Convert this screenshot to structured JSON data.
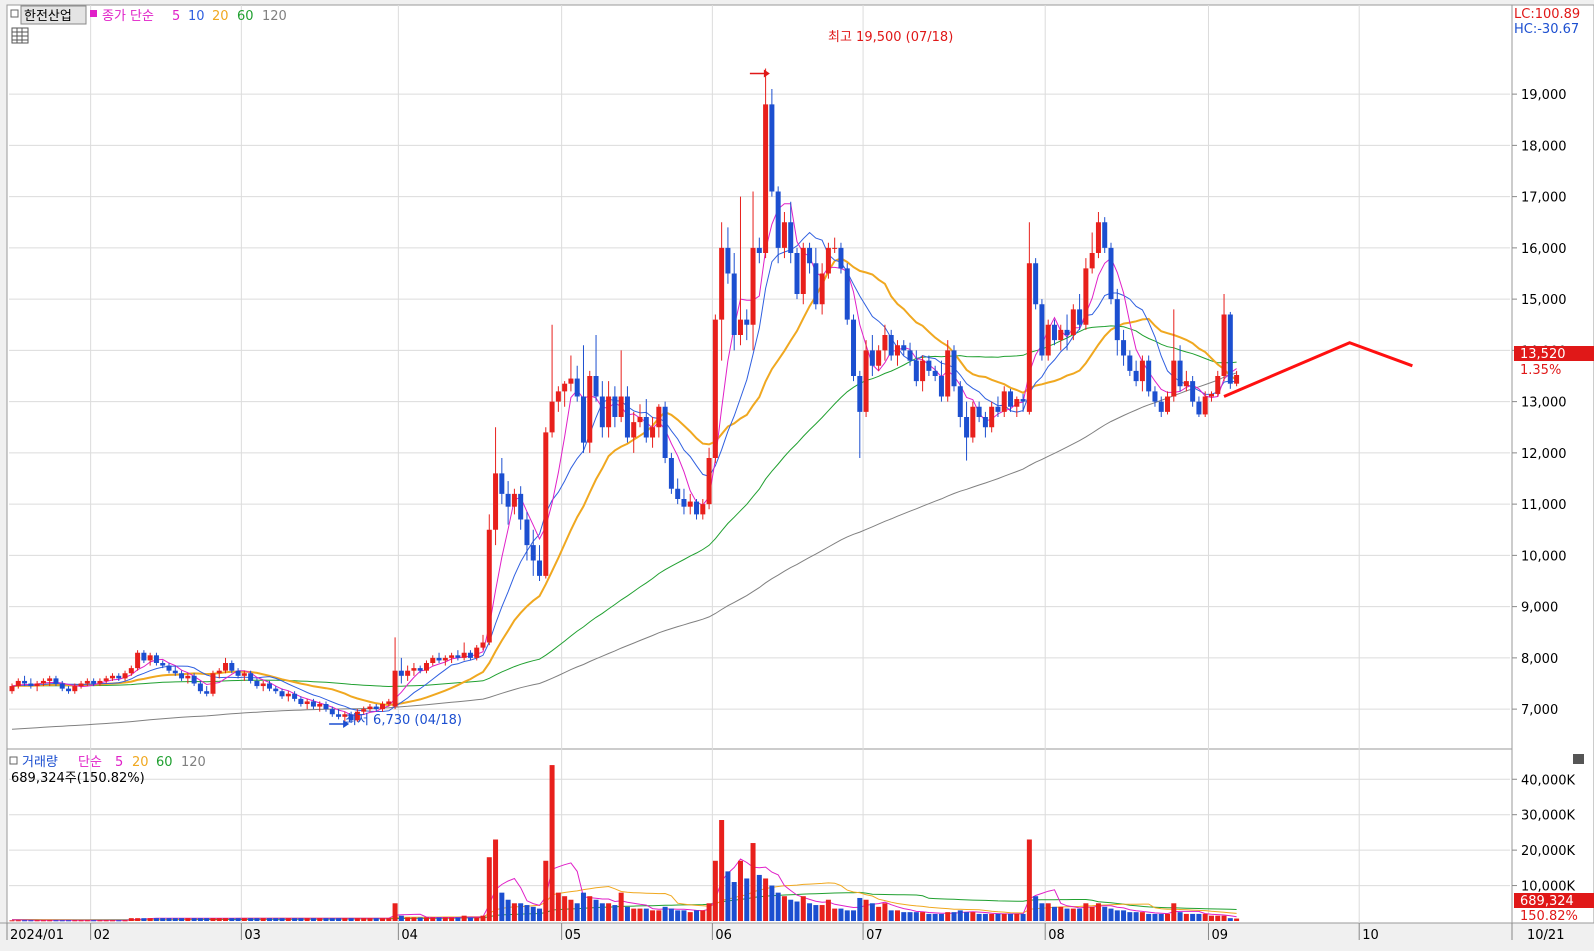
{
  "header": {
    "stock_name": "한전산업",
    "ma_label": "종가 단순",
    "ma_periods": [
      "5",
      "10",
      "20",
      "60",
      "120"
    ],
    "lc_text": "LC:100.89",
    "hc_text": "HC:-30.67"
  },
  "volume_header": {
    "label": "거래량",
    "ma_label": "단순",
    "ma_periods": [
      "5",
      "20",
      "60",
      "120"
    ],
    "value_text": "689,324주(150.82%)"
  },
  "annotations": {
    "high_text": "최고 19,500 (07/18)",
    "low_text": "최저 6,730 (04/18)",
    "price_badge": "13,520",
    "price_pct": "1.35%",
    "volume_badge": "689,324",
    "volume_pct": "150.82%"
  },
  "colors": {
    "up": "#e8201c",
    "down": "#1c4fd0",
    "ma5": "#e020c8",
    "ma10": "#3060e0",
    "ma20": "#f0a820",
    "ma60": "#20a030",
    "ma120": "#808080",
    "badge": "#e01818"
  },
  "chart_data": {
    "type": "candlestick",
    "price_axis": {
      "min": 6300,
      "max": 19900,
      "ticks": [
        "7,000",
        "8,000",
        "9,000",
        "10,000",
        "11,000",
        "12,000",
        "13,000",
        "14,000",
        "15,000",
        "16,000",
        "17,000",
        "18,000",
        "19,000"
      ]
    },
    "volume_axis": {
      "min": 0,
      "max": 46000,
      "ticks": [
        "10,000K",
        "20,000K",
        "30,000K",
        "40,000K"
      ]
    },
    "x_labels": [
      "2024/01",
      "02",
      "03",
      "04",
      "05",
      "06",
      "07",
      "08",
      "09",
      "10",
      "10/21"
    ],
    "candles": [
      [
        7350,
        7500,
        7300,
        7450,
        200
      ],
      [
        7450,
        7600,
        7400,
        7550,
        200
      ],
      [
        7550,
        7650,
        7450,
        7500,
        200
      ],
      [
        7500,
        7600,
        7400,
        7450,
        200
      ],
      [
        7450,
        7550,
        7350,
        7500,
        200
      ],
      [
        7500,
        7600,
        7450,
        7550,
        200
      ],
      [
        7550,
        7650,
        7450,
        7600,
        200
      ],
      [
        7600,
        7650,
        7450,
        7500,
        200
      ],
      [
        7500,
        7550,
        7350,
        7400,
        200
      ],
      [
        7400,
        7450,
        7300,
        7350,
        200
      ],
      [
        7350,
        7500,
        7300,
        7450,
        200
      ],
      [
        7450,
        7550,
        7400,
        7500,
        200
      ],
      [
        7500,
        7600,
        7450,
        7550,
        200
      ],
      [
        7550,
        7600,
        7450,
        7500,
        200
      ],
      [
        7500,
        7600,
        7450,
        7550,
        200
      ],
      [
        7550,
        7650,
        7500,
        7600,
        200
      ],
      [
        7600,
        7700,
        7550,
        7650,
        200
      ],
      [
        7650,
        7700,
        7550,
        7600,
        200
      ],
      [
        7600,
        7750,
        7550,
        7700,
        200
      ],
      [
        7700,
        7850,
        7650,
        7800,
        800
      ],
      [
        7800,
        8150,
        7750,
        8100,
        800
      ],
      [
        8100,
        8150,
        7900,
        7950,
        800
      ],
      [
        7950,
        8100,
        7850,
        8050,
        800
      ],
      [
        8050,
        8100,
        7850,
        7900,
        800
      ],
      [
        7900,
        7950,
        7800,
        7850,
        800
      ],
      [
        7850,
        7900,
        7700,
        7750,
        800
      ],
      [
        7750,
        7850,
        7650,
        7700,
        800
      ],
      [
        7700,
        7750,
        7550,
        7600,
        800
      ],
      [
        7600,
        7700,
        7500,
        7650,
        800
      ],
      [
        7650,
        7700,
        7450,
        7500,
        800
      ],
      [
        7500,
        7550,
        7300,
        7350,
        800
      ],
      [
        7350,
        7450,
        7250,
        7300,
        800
      ],
      [
        7300,
        7750,
        7250,
        7700,
        800
      ],
      [
        7700,
        7800,
        7600,
        7750,
        800
      ],
      [
        7750,
        8000,
        7700,
        7900,
        800
      ],
      [
        7900,
        7950,
        7700,
        7750,
        800
      ],
      [
        7750,
        7800,
        7600,
        7650,
        800
      ],
      [
        7650,
        7750,
        7550,
        7700,
        800
      ],
      [
        7700,
        7750,
        7500,
        7550,
        800
      ],
      [
        7550,
        7600,
        7400,
        7450,
        800
      ],
      [
        7450,
        7550,
        7350,
        7500,
        800
      ],
      [
        7500,
        7550,
        7350,
        7400,
        800
      ],
      [
        7400,
        7450,
        7300,
        7350,
        800
      ],
      [
        7350,
        7400,
        7200,
        7250,
        800
      ],
      [
        7250,
        7350,
        7150,
        7300,
        800
      ],
      [
        7300,
        7350,
        7150,
        7200,
        800
      ],
      [
        7200,
        7250,
        7050,
        7100,
        800
      ],
      [
        7100,
        7200,
        7000,
        7150,
        800
      ],
      [
        7150,
        7200,
        7000,
        7050,
        800
      ],
      [
        7050,
        7150,
        6950,
        7100,
        800
      ],
      [
        7100,
        7150,
        6950,
        7000,
        800
      ],
      [
        7000,
        7050,
        6850,
        6900,
        800
      ],
      [
        6900,
        7000,
        6800,
        6850,
        800
      ],
      [
        6850,
        6950,
        6750,
        6900,
        800
      ],
      [
        6900,
        6950,
        6730,
        6780,
        800
      ],
      [
        6780,
        7000,
        6750,
        6950,
        800
      ],
      [
        6950,
        7050,
        6900,
        7000,
        800
      ],
      [
        7000,
        7100,
        6950,
        7050,
        800
      ],
      [
        7050,
        7100,
        6950,
        7000,
        800
      ],
      [
        7000,
        7150,
        6950,
        7100,
        800
      ],
      [
        7100,
        7200,
        7050,
        7150,
        800
      ],
      [
        7050,
        8400,
        7000,
        7750,
        5000
      ],
      [
        7750,
        8000,
        7500,
        7650,
        1500
      ],
      [
        7650,
        7850,
        7550,
        7750,
        1000
      ],
      [
        7750,
        7900,
        7650,
        7800,
        1000
      ],
      [
        7800,
        7850,
        7700,
        7750,
        1000
      ],
      [
        7750,
        7950,
        7700,
        7900,
        1000
      ],
      [
        7900,
        8050,
        7850,
        8000,
        1000
      ],
      [
        8000,
        8100,
        7900,
        7950,
        1000
      ],
      [
        7950,
        8050,
        7850,
        8000,
        1000
      ],
      [
        8000,
        8100,
        7900,
        8050,
        1000
      ],
      [
        8050,
        8150,
        7950,
        8000,
        1000
      ],
      [
        8000,
        8300,
        7950,
        8100,
        1500
      ],
      [
        8100,
        8150,
        7950,
        8000,
        1000
      ],
      [
        8000,
        8250,
        7950,
        8200,
        1000
      ],
      [
        8200,
        8450,
        8150,
        8300,
        1500
      ],
      [
        8300,
        10800,
        8250,
        10500,
        18000
      ],
      [
        10500,
        12500,
        10200,
        11600,
        23000
      ],
      [
        11600,
        11900,
        11000,
        11200,
        8000
      ],
      [
        11200,
        11450,
        10600,
        10950,
        6000
      ],
      [
        10950,
        11300,
        10800,
        11200,
        5000
      ],
      [
        11200,
        11350,
        10500,
        10700,
        5000
      ],
      [
        10700,
        10850,
        9900,
        10200,
        4500
      ],
      [
        10200,
        10500,
        9600,
        9900,
        4000
      ],
      [
        9900,
        10200,
        9500,
        9600,
        3500
      ],
      [
        9600,
        12500,
        9550,
        12400,
        17000
      ],
      [
        12400,
        14500,
        12300,
        13000,
        44000
      ],
      [
        13000,
        13300,
        12800,
        13200,
        8000
      ],
      [
        13200,
        13400,
        12900,
        13350,
        7000
      ],
      [
        13350,
        13900,
        13200,
        13450,
        6000
      ],
      [
        13450,
        13700,
        13000,
        13100,
        5000
      ],
      [
        13100,
        14100,
        12000,
        12200,
        8000
      ],
      [
        12200,
        13600,
        12000,
        13500,
        7000
      ],
      [
        13500,
        14300,
        13000,
        13100,
        6000
      ],
      [
        13100,
        13400,
        12300,
        12500,
        5000
      ],
      [
        12500,
        13400,
        12300,
        13100,
        5000
      ],
      [
        13100,
        13300,
        12500,
        12700,
        4500
      ],
      [
        12700,
        14000,
        12600,
        13100,
        8000
      ],
      [
        13100,
        13300,
        12200,
        12300,
        4000
      ],
      [
        12300,
        12800,
        12000,
        12600,
        3500
      ],
      [
        12600,
        12950,
        12500,
        12700,
        3500
      ],
      [
        12700,
        13050,
        12200,
        12300,
        3500
      ],
      [
        12300,
        12700,
        12100,
        12500,
        3000
      ],
      [
        12500,
        12950,
        12300,
        12900,
        3000
      ],
      [
        12900,
        13000,
        11800,
        11900,
        4000
      ],
      [
        11900,
        12000,
        11200,
        11300,
        3500
      ],
      [
        11300,
        11500,
        11000,
        11100,
        3000
      ],
      [
        11100,
        11300,
        10800,
        10950,
        3000
      ],
      [
        10950,
        11200,
        10800,
        11050,
        2500
      ],
      [
        11050,
        11100,
        10700,
        10800,
        3000
      ],
      [
        10800,
        11100,
        10700,
        11000,
        3000
      ],
      [
        11000,
        12100,
        10900,
        11900,
        5000
      ],
      [
        11900,
        14700,
        11800,
        14600,
        17000
      ],
      [
        14600,
        16500,
        13800,
        16000,
        28500
      ],
      [
        16000,
        16400,
        15300,
        15500,
        14000
      ],
      [
        15500,
        15900,
        14000,
        14300,
        11000
      ],
      [
        14300,
        17000,
        14100,
        14600,
        17000
      ],
      [
        14600,
        14800,
        14200,
        14500,
        12000
      ],
      [
        14500,
        17100,
        14000,
        16000,
        22000
      ],
      [
        16000,
        16200,
        15700,
        15900,
        13000
      ],
      [
        15900,
        19500,
        15800,
        18800,
        12000
      ],
      [
        18800,
        19100,
        17000,
        17100,
        10000
      ],
      [
        17100,
        17200,
        15700,
        16000,
        8000
      ],
      [
        16000,
        16700,
        15800,
        16500,
        7000
      ],
      [
        16500,
        16900,
        15700,
        15900,
        6000
      ],
      [
        15900,
        16000,
        15000,
        15100,
        5500
      ],
      [
        15100,
        16100,
        14900,
        16000,
        7000
      ],
      [
        16000,
        16100,
        15500,
        15700,
        5000
      ],
      [
        15700,
        16000,
        14800,
        14900,
        4500
      ],
      [
        14900,
        15700,
        14700,
        15500,
        4500
      ],
      [
        15500,
        16100,
        15400,
        16000,
        6000
      ],
      [
        16000,
        16200,
        15900,
        16000,
        3500
      ],
      [
        16000,
        16100,
        15500,
        15600,
        3500
      ],
      [
        15600,
        15700,
        14500,
        14600,
        3000
      ],
      [
        14600,
        14700,
        13400,
        13500,
        3000
      ],
      [
        13500,
        13600,
        11900,
        12800,
        6500
      ],
      [
        12800,
        14200,
        12700,
        14000,
        6000
      ],
      [
        14000,
        14300,
        13500,
        13700,
        5000
      ],
      [
        13700,
        14100,
        13600,
        14000,
        4000
      ],
      [
        14000,
        14500,
        13800,
        14300,
        5000
      ],
      [
        14300,
        14400,
        13800,
        13900,
        3000
      ],
      [
        13900,
        14200,
        13700,
        14100,
        3000
      ],
      [
        14100,
        14200,
        13900,
        14000,
        2500
      ],
      [
        14000,
        14150,
        13700,
        13800,
        2500
      ],
      [
        13800,
        14000,
        13300,
        13400,
        2500
      ],
      [
        13400,
        13900,
        13200,
        13800,
        2500
      ],
      [
        13800,
        13900,
        13500,
        13600,
        2000
      ],
      [
        13600,
        13700,
        13400,
        13500,
        2000
      ],
      [
        13500,
        13800,
        13000,
        13100,
        2000
      ],
      [
        13100,
        14200,
        13000,
        14000,
        2500
      ],
      [
        14000,
        14100,
        13200,
        13300,
        2500
      ],
      [
        13300,
        13400,
        12500,
        12700,
        3000
      ],
      [
        12700,
        13000,
        11850,
        12300,
        2500
      ],
      [
        12300,
        13000,
        12200,
        12900,
        2500
      ],
      [
        12900,
        13000,
        12600,
        12700,
        2000
      ],
      [
        12700,
        12800,
        12300,
        12500,
        2000
      ],
      [
        12500,
        13000,
        12400,
        12900,
        2000
      ],
      [
        12900,
        13100,
        12700,
        12800,
        2000
      ],
      [
        12800,
        13300,
        12700,
        13200,
        2000
      ],
      [
        13200,
        13250,
        12800,
        12900,
        2000
      ],
      [
        12900,
        13100,
        12700,
        13050,
        2000
      ],
      [
        13050,
        13150,
        12800,
        13000,
        2000
      ],
      [
        12800,
        16500,
        12750,
        15700,
        23000
      ],
      [
        15700,
        15800,
        14800,
        14900,
        7000
      ],
      [
        14900,
        15000,
        13800,
        13900,
        5000
      ],
      [
        13900,
        14600,
        13800,
        14500,
        5000
      ],
      [
        14500,
        14600,
        14100,
        14200,
        4000
      ],
      [
        14200,
        14500,
        14000,
        14400,
        4000
      ],
      [
        14400,
        14700,
        14000,
        14300,
        3500
      ],
      [
        14300,
        14900,
        14200,
        14800,
        3500
      ],
      [
        14800,
        15100,
        14400,
        14500,
        3500
      ],
      [
        14500,
        15800,
        14400,
        15600,
        5000
      ],
      [
        15600,
        16300,
        15500,
        15900,
        4000
      ],
      [
        15900,
        16700,
        15800,
        16500,
        5000
      ],
      [
        16500,
        16600,
        15900,
        16000,
        4000
      ],
      [
        16000,
        16100,
        14900,
        15000,
        3500
      ],
      [
        15000,
        15200,
        13900,
        14200,
        3000
      ],
      [
        14200,
        14400,
        13700,
        13900,
        3000
      ],
      [
        13900,
        14000,
        13500,
        13600,
        2500
      ],
      [
        13600,
        13800,
        13300,
        13400,
        2500
      ],
      [
        13400,
        13900,
        13200,
        13800,
        2500
      ],
      [
        13800,
        13900,
        13100,
        13200,
        2000
      ],
      [
        13200,
        13300,
        12900,
        13000,
        2000
      ],
      [
        13000,
        13100,
        12700,
        12800,
        2000
      ],
      [
        12800,
        13200,
        12750,
        13100,
        2000
      ],
      [
        13100,
        14800,
        13000,
        13800,
        5000
      ],
      [
        13800,
        14100,
        13200,
        13300,
        2500
      ],
      [
        13300,
        13600,
        13200,
        13400,
        2000
      ],
      [
        13400,
        13500,
        12900,
        13000,
        2000
      ],
      [
        13000,
        13100,
        12700,
        12750,
        2000
      ],
      [
        12750,
        13200,
        12700,
        13100,
        2000
      ],
      [
        13100,
        13200,
        13000,
        13150,
        1500
      ],
      [
        13150,
        13600,
        13100,
        13500,
        1500
      ],
      [
        13500,
        15100,
        13400,
        14700,
        1500
      ],
      [
        14700,
        14750,
        13250,
        13350,
        800
      ],
      [
        13350,
        13600,
        13300,
        13520,
        690
      ]
    ],
    "trend_line": [
      [
        193,
        13100
      ],
      [
        213,
        14150
      ],
      [
        223,
        13700
      ]
    ],
    "high_marker": {
      "index": 121,
      "price": 19500
    },
    "low_marker": {
      "index": 54,
      "price": 6730
    }
  }
}
